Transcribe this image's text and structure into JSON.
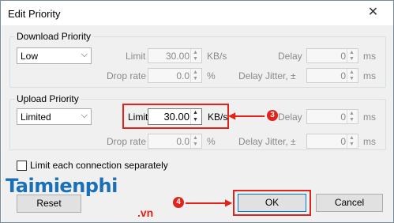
{
  "window": {
    "title": "Edit Priority",
    "close_glyph": "✕"
  },
  "download": {
    "legend": "Download Priority",
    "combo_value": "Low",
    "limit_label": "Limit",
    "limit_value": "30.00",
    "limit_unit": "KB/s",
    "delay_label": "Delay",
    "delay_value": "0",
    "delay_unit": "ms",
    "drop_label": "Drop rate",
    "drop_value": "0.0",
    "drop_unit": "%",
    "jitter_label": "Delay Jitter, ±",
    "jitter_value": "0",
    "jitter_unit": "ms"
  },
  "upload": {
    "legend": "Upload Priority",
    "combo_value": "Limited",
    "limit_label": "Limit",
    "limit_value": "30.00",
    "limit_unit": "KB/s",
    "delay_label": "Delay",
    "delay_value": "0",
    "delay_unit": "ms",
    "drop_label": "Drop rate",
    "drop_value": "0.0",
    "drop_unit": "%",
    "jitter_label": "Delay Jitter, ±",
    "jitter_value": "0",
    "jitter_unit": "ms"
  },
  "options": {
    "separate_label": "Limit each connection separately",
    "separate_checked": false
  },
  "buttons": {
    "reset": "Reset",
    "ok": "OK",
    "cancel": "Cancel"
  },
  "annotations": {
    "marker_3": "3",
    "marker_4": "4",
    "color": "#e2231a"
  },
  "watermark": {
    "brand": "Taimienphi",
    "suffix": ".vn"
  }
}
